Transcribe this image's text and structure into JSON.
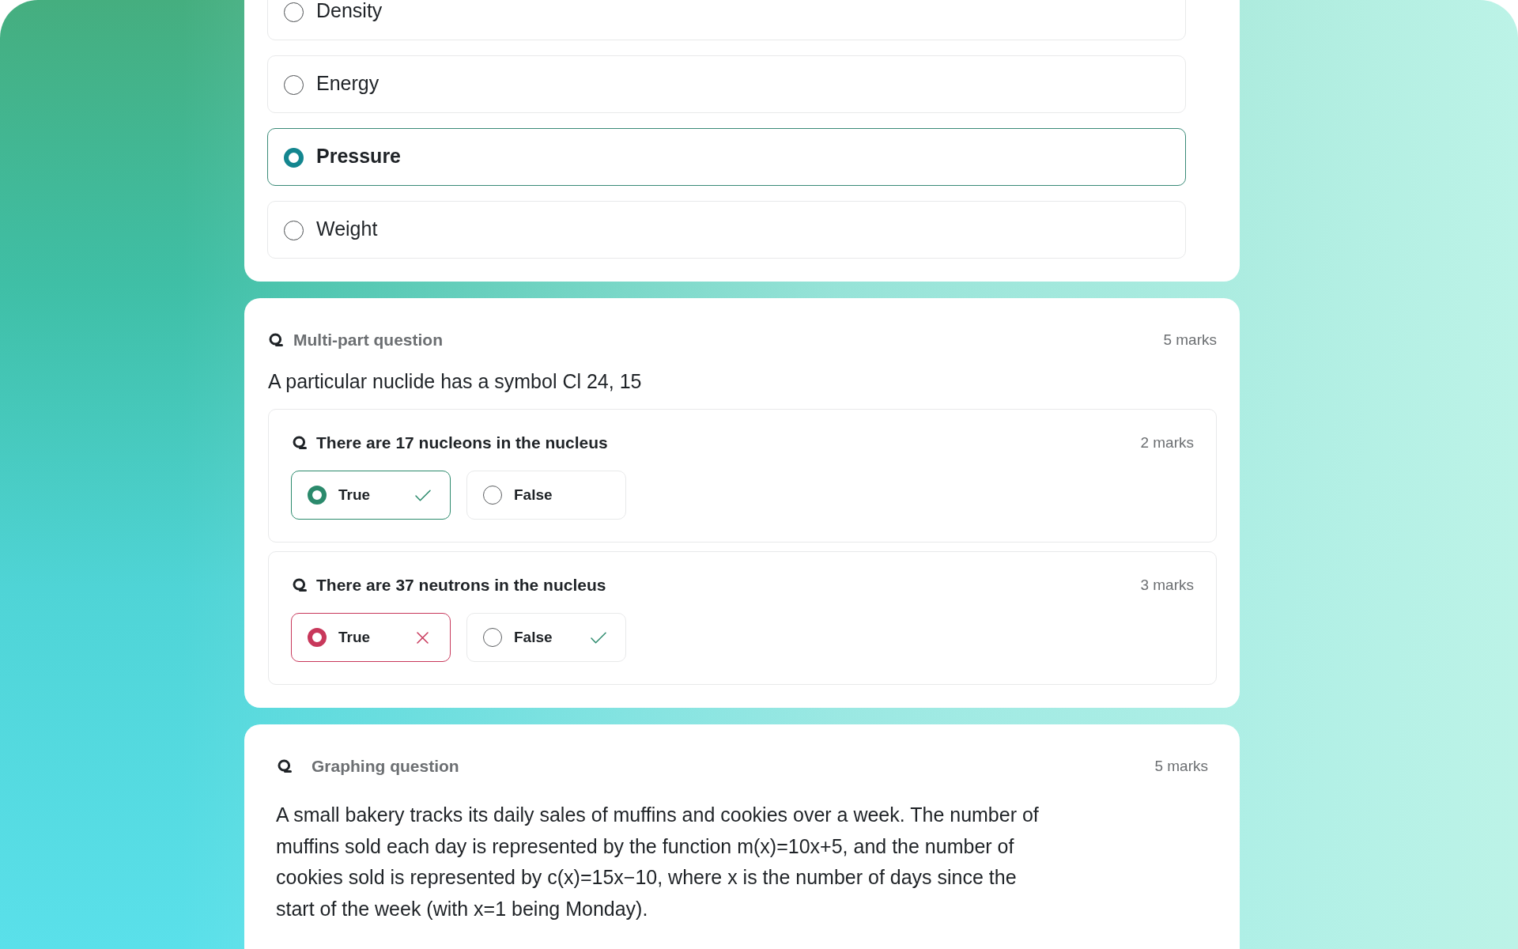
{
  "questions": [
    {
      "kind": "multiple_choice",
      "options": [
        {
          "label": "Density",
          "selected": false
        },
        {
          "label": "Energy",
          "selected": false
        },
        {
          "label": "Pressure",
          "selected": true
        },
        {
          "label": "Weight",
          "selected": false
        }
      ]
    },
    {
      "kind": "multi_part",
      "type_label": "Multi-part question",
      "marks": "5 marks",
      "stem": "A particular nuclide has a symbol Cl 24, 15",
      "parts": [
        {
          "prompt": "There are 17 nucleons in the nucleus",
          "marks": "2 marks",
          "options": [
            {
              "label": "True",
              "selected": true,
              "correct": true,
              "wrong": false
            },
            {
              "label": "False",
              "selected": false,
              "correct": false,
              "wrong": false
            }
          ]
        },
        {
          "prompt": "There are 37 neutrons in the nucleus",
          "marks": "3 marks",
          "options": [
            {
              "label": "True",
              "selected": true,
              "correct": false,
              "wrong": true
            },
            {
              "label": "False",
              "selected": false,
              "correct": true,
              "wrong": false
            }
          ]
        }
      ]
    },
    {
      "kind": "graphing",
      "type_label": "Graphing question",
      "marks": "5 marks",
      "stem": "A small bakery tracks its daily sales of muffins and cookies over a week. The number of muffins sold each day is represented by the function m(x)=10x+5, and the number of cookies sold is represented by c(x)=15x−10, where x is the number of days since the start of the week (with x=1 being Monday)."
    }
  ]
}
